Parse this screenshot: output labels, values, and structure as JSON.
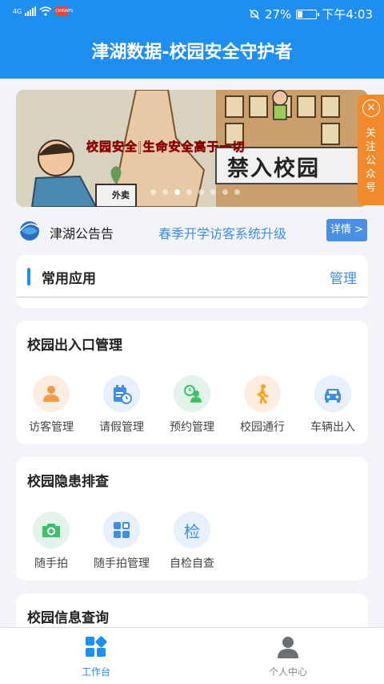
{
  "status": {
    "network": "4G",
    "app_badge": "CHINAPS",
    "battery": "27%",
    "battery_fill": 0.27,
    "time": "下午4:03",
    "icons": [
      "signal-icon",
      "wifi-icon",
      "mute-icon",
      "battery-icon"
    ]
  },
  "header": {
    "title": "津湖数据-校园安全守护者"
  },
  "banner": {
    "slogan": "校园安全|生命安全高于一切",
    "sign": "禁入校园",
    "box_label": "外卖",
    "slide_count": 8,
    "active_slide": 2,
    "follow": {
      "close": "×",
      "label": "关注公众号"
    }
  },
  "notice": {
    "name": "津湖公告告",
    "message": "春季开学访客系统升级",
    "more": "详情 >"
  },
  "common_apps": {
    "title": "常用应用",
    "manage": "管理"
  },
  "sections": [
    {
      "title": "校园出入口管理",
      "items": [
        {
          "label": "访客管理",
          "icon": "person-icon",
          "color": "#f59a4a",
          "bg": "bg-orange"
        },
        {
          "label": "请假管理",
          "icon": "calendar-clock-icon",
          "color": "#3f8ee0",
          "bg": "bg-blue"
        },
        {
          "label": "预约管理",
          "icon": "appointment-icon",
          "color": "#3fbf6b",
          "bg": "bg-green"
        },
        {
          "label": "校园通行",
          "icon": "walking-icon",
          "color": "#f5a623",
          "bg": "bg-orange"
        },
        {
          "label": "车辆出入",
          "icon": "car-icon",
          "color": "#3f8ee0",
          "bg": "bg-blue"
        }
      ]
    },
    {
      "title": "校园隐患排查",
      "items": [
        {
          "label": "随手拍",
          "icon": "camera-icon",
          "color": "#3fbf6b",
          "bg": "bg-green"
        },
        {
          "label": "随手拍管理",
          "icon": "grid-icon",
          "color": "#3f8ee0",
          "bg": "bg-blue"
        },
        {
          "label": "自检自查",
          "icon": "check-char-icon",
          "char": "检",
          "color": "#3f8ee0",
          "bg": "bg-blue"
        }
      ]
    },
    {
      "title": "校园信息查询",
      "items": []
    }
  ],
  "tabbar": {
    "work": "工作台",
    "me": "个人中心",
    "active_color": "#1e8ef0"
  }
}
